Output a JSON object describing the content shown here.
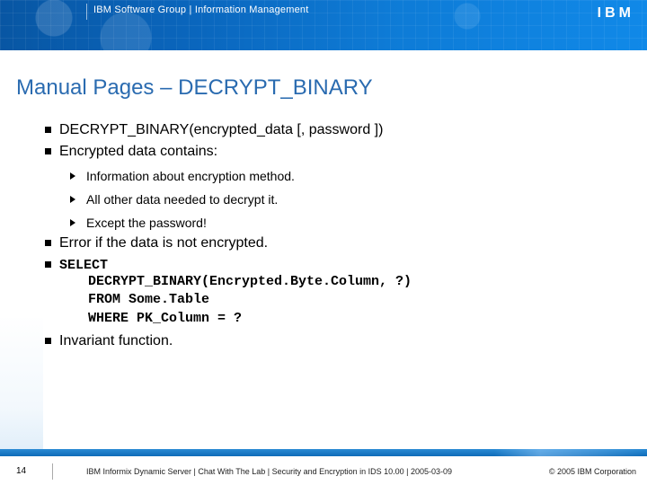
{
  "header": {
    "breadcrumb": "IBM Software Group | Information Management",
    "logo_text": "IBM"
  },
  "title": "Manual Pages – DECRYPT_BINARY",
  "bullets": {
    "sig": "DECRYPT_BINARY(encrypted_data [, password ])",
    "contains": "Encrypted data contains:",
    "sub": {
      "a": "Information about encryption method.",
      "b": "All other data needed to decrypt it.",
      "c": "Except the password!"
    },
    "error": "Error if the data is not encrypted.",
    "select_head": "SELECT",
    "code": {
      "l1": "DECRYPT_BINARY(Encrypted.Byte.Column, ?)",
      "l2": "FROM Some.Table",
      "l3": "WHERE PK_Column = ?"
    },
    "invariant": "Invariant function."
  },
  "footer": {
    "page": "14",
    "mid": "IBM Informix Dynamic Server  |  Chat With The Lab  |  Security and Encryption in IDS 10.00  |  2005-03-09",
    "right": "© 2005 IBM Corporation"
  }
}
